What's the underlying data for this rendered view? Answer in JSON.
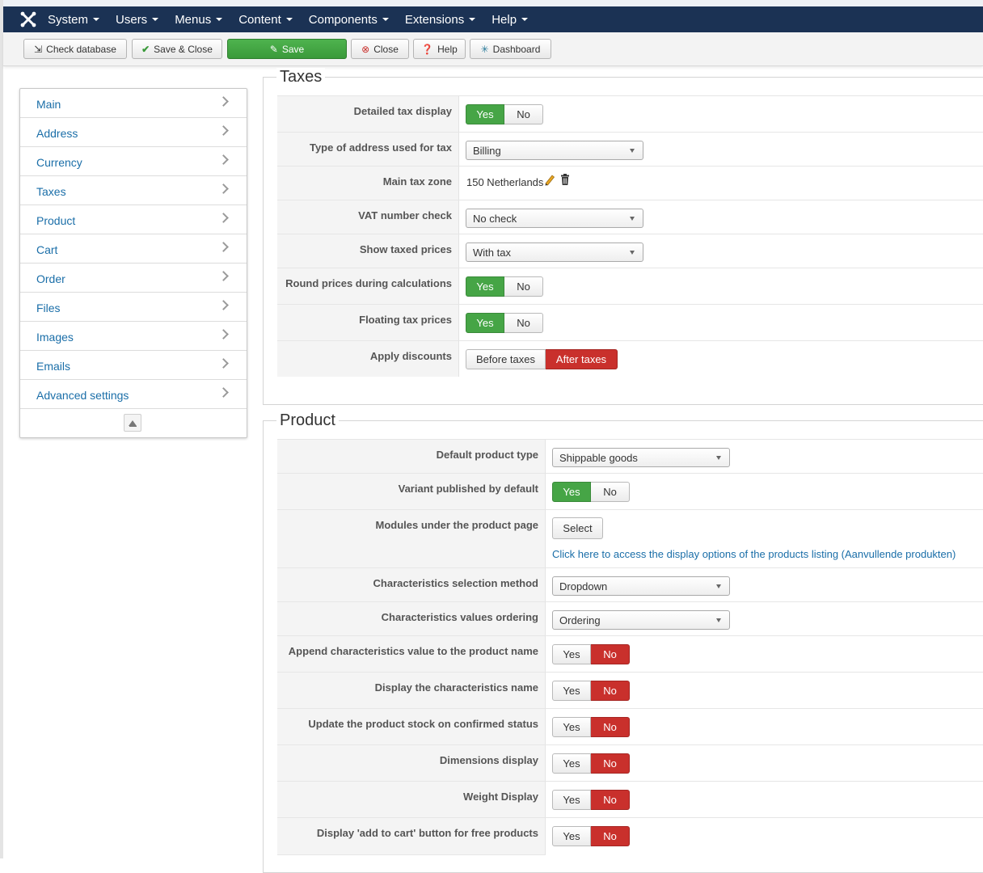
{
  "menubar": {
    "items": [
      "System",
      "Users",
      "Menus",
      "Content",
      "Components",
      "Extensions",
      "Help"
    ]
  },
  "toolbar": {
    "check_database": "Check database",
    "save_close": "Save & Close",
    "save": "Save",
    "close": "Close",
    "help": "Help",
    "dashboard": "Dashboard"
  },
  "sidebar": {
    "items": [
      "Main",
      "Address",
      "Currency",
      "Taxes",
      "Product",
      "Cart",
      "Order",
      "Files",
      "Images",
      "Emails",
      "Advanced settings"
    ]
  },
  "taxes": {
    "title": "Taxes",
    "detailed_tax_display": {
      "label": "Detailed tax display",
      "yes": "Yes",
      "no": "No",
      "value": "Yes"
    },
    "address_type": {
      "label": "Type of address used for tax",
      "value": "Billing"
    },
    "main_tax_zone": {
      "label": "Main tax zone",
      "value": "150 Netherlands"
    },
    "vat_check": {
      "label": "VAT number check",
      "value": "No check"
    },
    "show_taxed": {
      "label": "Show taxed prices",
      "value": "With tax"
    },
    "round_prices": {
      "label": "Round prices during calculations",
      "yes": "Yes",
      "no": "No",
      "value": "Yes"
    },
    "floating_tax": {
      "label": "Floating tax prices",
      "yes": "Yes",
      "no": "No",
      "value": "Yes"
    },
    "apply_discounts": {
      "label": "Apply discounts",
      "before": "Before taxes",
      "after": "After taxes",
      "value": "After taxes"
    }
  },
  "product": {
    "title": "Product",
    "default_type": {
      "label": "Default product type",
      "value": "Shippable goods"
    },
    "variant_published": {
      "label": "Variant published by default",
      "yes": "Yes",
      "no": "No",
      "value": "Yes"
    },
    "modules": {
      "label": "Modules under the product page",
      "button": "Select",
      "link": "Click here to access the display options of the products listing (Aanvullende produkten)"
    },
    "char_method": {
      "label": "Characteristics selection method",
      "value": "Dropdown"
    },
    "char_ordering": {
      "label": "Characteristics values ordering",
      "value": "Ordering"
    },
    "append_char": {
      "label": "Append characteristics value to the product name",
      "yes": "Yes",
      "no": "No",
      "value": "No"
    },
    "display_char_name": {
      "label": "Display the characteristics name",
      "yes": "Yes",
      "no": "No",
      "value": "No"
    },
    "update_stock": {
      "label": "Update the product stock on confirmed status",
      "yes": "Yes",
      "no": "No",
      "value": "No"
    },
    "dimensions": {
      "label": "Dimensions display",
      "yes": "Yes",
      "no": "No",
      "value": "No"
    },
    "weight": {
      "label": "Weight Display",
      "yes": "Yes",
      "no": "No",
      "value": "No"
    },
    "add_to_cart_free": {
      "label": "Display 'add to cart' button for free products",
      "yes": "Yes",
      "no": "No",
      "value": "No"
    }
  },
  "colors": {
    "navy": "#1b3254",
    "green": "#46a546",
    "red": "#c9302c",
    "link": "#1a6ea8"
  }
}
